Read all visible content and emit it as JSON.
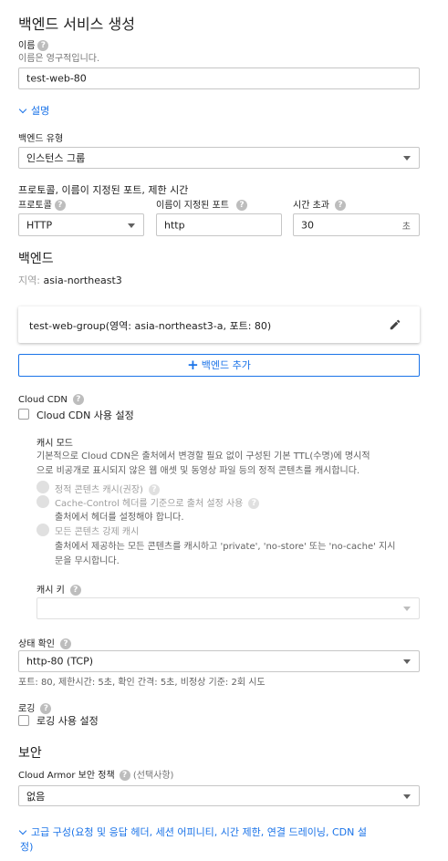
{
  "page_title": "백엔드 서비스 생성",
  "name": {
    "label": "이름",
    "hint": "이름은 영구적입니다.",
    "value": "test-web-80"
  },
  "description_toggle": "설명",
  "backend_type": {
    "label": "백엔드 유형",
    "value": "인스턴스 그룹"
  },
  "protocol_section": {
    "title": "프로토콜, 이름이 지정된 포트, 제한 시간",
    "protocol_label": "프로토콜",
    "protocol_value": "HTTP",
    "named_port_label": "이름이 지정된 포트",
    "named_port_value": "http",
    "timeout_label": "시간 초과",
    "timeout_value": "30",
    "timeout_unit": "초"
  },
  "backends": {
    "title": "백엔드",
    "region_label": "지역:",
    "region_value": "asia-northeast3",
    "backend_item": "test-web-group(영역: asia-northeast3-a, 포트: 80)",
    "add_button": "백엔드 추가"
  },
  "cdn": {
    "label": "Cloud CDN",
    "checkbox_label": "Cloud CDN 사용 설정",
    "cache_mode_title": "캐시 모드",
    "cache_mode_desc_1": "기본적으로 Cloud CDN은 출처에서 변경할 필요 없이 구성된 기본 TTL(수명)에 명시적",
    "cache_mode_desc_2": "으로 비공개로 표시되지 않은 웹 애셋 및 동영상 파일 등의 정적 콘텐츠를 캐시합니다.",
    "option_static": "정적 콘텐츠 캐시(권장)",
    "option_header": "Cache-Control 헤더를 기준으로 출처 설정 사용",
    "option_header_desc": "출처에서 헤더를 설정해야 합니다.",
    "option_force": "모든 콘텐츠 강제 캐시",
    "option_force_desc_1": "출처에서 제공하는 모든 콘텐츠를 캐시하고 'private', 'no-store' 또는 'no-cache' 지시",
    "option_force_desc_2": "문을 무시합니다.",
    "cache_key_label": "캐시 키",
    "cache_key_value": ""
  },
  "health_check": {
    "label": "상태 확인",
    "value": "http-80 (TCP)",
    "summary": "포트: 80, 제한시간: 5초, 확인 간격: 5초, 비정상 기준: 2회 시도"
  },
  "logging": {
    "label": "로깅",
    "checkbox_label": "로깅 사용 설정"
  },
  "security": {
    "title": "보안",
    "armor_label": "Cloud Armor 보안 정책",
    "armor_optional": "(선택사항)",
    "armor_value": "없음"
  },
  "advanced": {
    "line1": "고급 구성(요청 및 응답 헤더, 세션 어피니티, 시간 제한, 연결 드레이닝, CDN 설",
    "line2": "정)"
  },
  "colors": {
    "accent": "#1a73e8",
    "border": "#c6c6c6",
    "help_icon": "#bdbdbd"
  }
}
